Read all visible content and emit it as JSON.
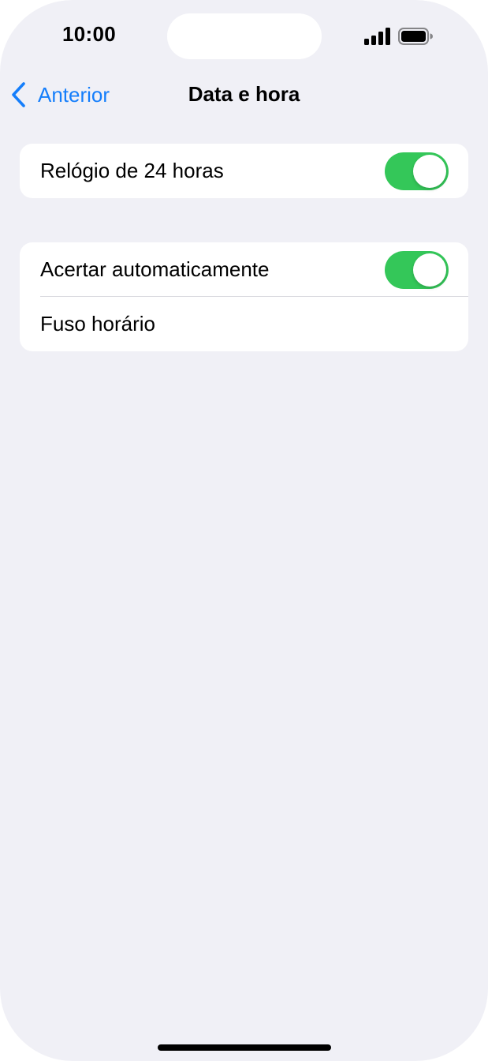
{
  "status_bar": {
    "time": "10:00",
    "signal_icon": "cellular-signal-icon",
    "battery_icon": "battery-full-icon"
  },
  "nav": {
    "back_label": "Anterior",
    "back_icon": "chevron-left-icon",
    "title": "Data e hora"
  },
  "groups": [
    {
      "rows": [
        {
          "label": "Relógio de 24 horas",
          "toggle": true
        }
      ]
    },
    {
      "rows": [
        {
          "label": "Acertar automaticamente",
          "toggle": true
        },
        {
          "label": "Fuso horário"
        }
      ]
    }
  ],
  "colors": {
    "accent": "#157efb",
    "toggle_on": "#34c759",
    "background": "#f0f0f6"
  }
}
